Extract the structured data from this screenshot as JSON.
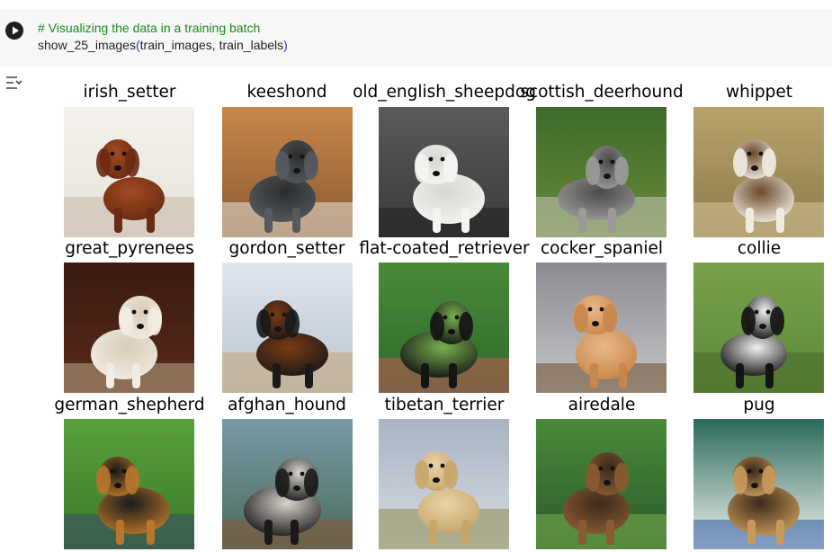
{
  "cell": {
    "code_comment": "# Visualizing the data in a training batch",
    "code_func": "show_25_images",
    "code_paren_open": "(",
    "code_args": "train_images, train_labels",
    "code_paren_close": ")"
  },
  "icons": {
    "run": "play-circle-icon",
    "output": "output-collapse-icon"
  },
  "images": [
    {
      "label": "irish_setter",
      "palette": [
        "#f4f1ec",
        "#e6e2dc",
        "#6b2a12",
        "#a04a22",
        "#c9b8a8"
      ]
    },
    {
      "label": "keeshond",
      "palette": [
        "#c8874a",
        "#8a5a32",
        "#555a5e",
        "#2c2c2c",
        "#e8e4dc"
      ]
    },
    {
      "label": "old_english_sheepdog",
      "palette": [
        "#5a5a5a",
        "#3a3a3a",
        "#f4f4f2",
        "#d8d6d0",
        "#222222"
      ]
    },
    {
      "label": "scottish_deerhound",
      "palette": [
        "#3e6b2a",
        "#6a8a3a",
        "#9a9a98",
        "#4a4a4a",
        "#c8c4b8"
      ]
    },
    {
      "label": "whippet",
      "palette": [
        "#b9a36b",
        "#8a7a4a",
        "#f0ebe2",
        "#6a4a2a",
        "#d9c99a"
      ]
    },
    {
      "label": "great_pyrenees",
      "palette": [
        "#3a1a12",
        "#5a2a1a",
        "#f2ece2",
        "#d8ccb8",
        "#b8a888"
      ]
    },
    {
      "label": "gordon_setter",
      "palette": [
        "#dfe6ee",
        "#b8c4d0",
        "#1a1a1a",
        "#7a3a12",
        "#c8a878"
      ]
    },
    {
      "label": "flat-coated_retriever",
      "palette": [
        "#4a8a3a",
        "#2e6a2a",
        "#141414",
        "#7ab050",
        "#c85a5a"
      ]
    },
    {
      "label": "cocker_spaniel",
      "palette": [
        "#8a8a90",
        "#c8c8ca",
        "#c9864a",
        "#e8b888",
        "#6a4a2a"
      ]
    },
    {
      "label": "collie",
      "palette": [
        "#7aa04a",
        "#5a8a3a",
        "#141414",
        "#f2f2f0",
        "#4a6a2a"
      ]
    },
    {
      "label": "german_shepherd",
      "palette": [
        "#5aa03a",
        "#3a7a2a",
        "#b8762a",
        "#1a1a1a",
        "#3a4a6a"
      ]
    },
    {
      "label": "afghan_hound",
      "palette": [
        "#7a9aa8",
        "#4a6a5a",
        "#1a1a1a",
        "#d8d4cc",
        "#8a5a3a"
      ]
    },
    {
      "label": "tibetan_terrier",
      "palette": [
        "#a8b4c2",
        "#d8dce4",
        "#c8a66a",
        "#e8d4a8",
        "#8a8a4a"
      ]
    },
    {
      "label": "airedale",
      "palette": [
        "#4a8a3a",
        "#2a5a2a",
        "#8a5a32",
        "#3a2a1a",
        "#7ab050"
      ]
    },
    {
      "label": "pug",
      "palette": [
        "#2a6a5a",
        "#f2f2f0",
        "#c89a5a",
        "#3a2a1a",
        "#2a5aa0"
      ]
    }
  ]
}
